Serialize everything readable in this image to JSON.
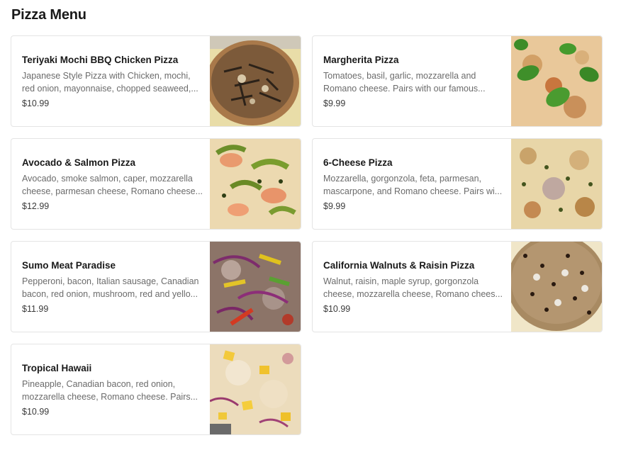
{
  "section": {
    "title": "Pizza Menu"
  },
  "items": [
    {
      "name": "Teriyaki Mochi BBQ Chicken Pizza",
      "description": "Japanese Style Pizza with Chicken, mochi, red onion, mayonnaise, chopped seaweed,...",
      "price": "$10.99",
      "image": "teriyaki-pizza-photo"
    },
    {
      "name": "Margherita Pizza",
      "description": "Tomatoes, basil, garlic, mozzarella and Romano cheese. Pairs with our famous...",
      "price": "$9.99",
      "image": "margherita-pizza-photo"
    },
    {
      "name": "Avocado & Salmon Pizza",
      "description": "Avocado, smoke salmon, caper, mozzarella cheese, parmesan cheese, Romano cheese...",
      "price": "$12.99",
      "image": "avocado-salmon-pizza-photo"
    },
    {
      "name": "6-Cheese Pizza",
      "description": "Mozzarella, gorgonzola, feta, parmesan, mascarpone, and Romano cheese. Pairs wi...",
      "price": "$9.99",
      "image": "six-cheese-pizza-photo"
    },
    {
      "name": "Sumo Meat Paradise",
      "description": "Pepperoni, bacon, Italian sausage, Canadian bacon, red onion, mushroom, red and yello...",
      "price": "$11.99",
      "image": "sumo-meat-pizza-photo"
    },
    {
      "name": "California Walnuts & Raisin Pizza",
      "description": "Walnut, raisin, maple syrup, gorgonzola cheese, mozzarella cheese, Romano chees...",
      "price": "$10.99",
      "image": "walnut-raisin-pizza-photo"
    },
    {
      "name": "Tropical Hawaii",
      "description": "Pineapple, Canadian bacon, red onion, mozzarella cheese, Romano cheese. Pairs...",
      "price": "$10.99",
      "image": "tropical-hawaii-pizza-photo"
    }
  ]
}
